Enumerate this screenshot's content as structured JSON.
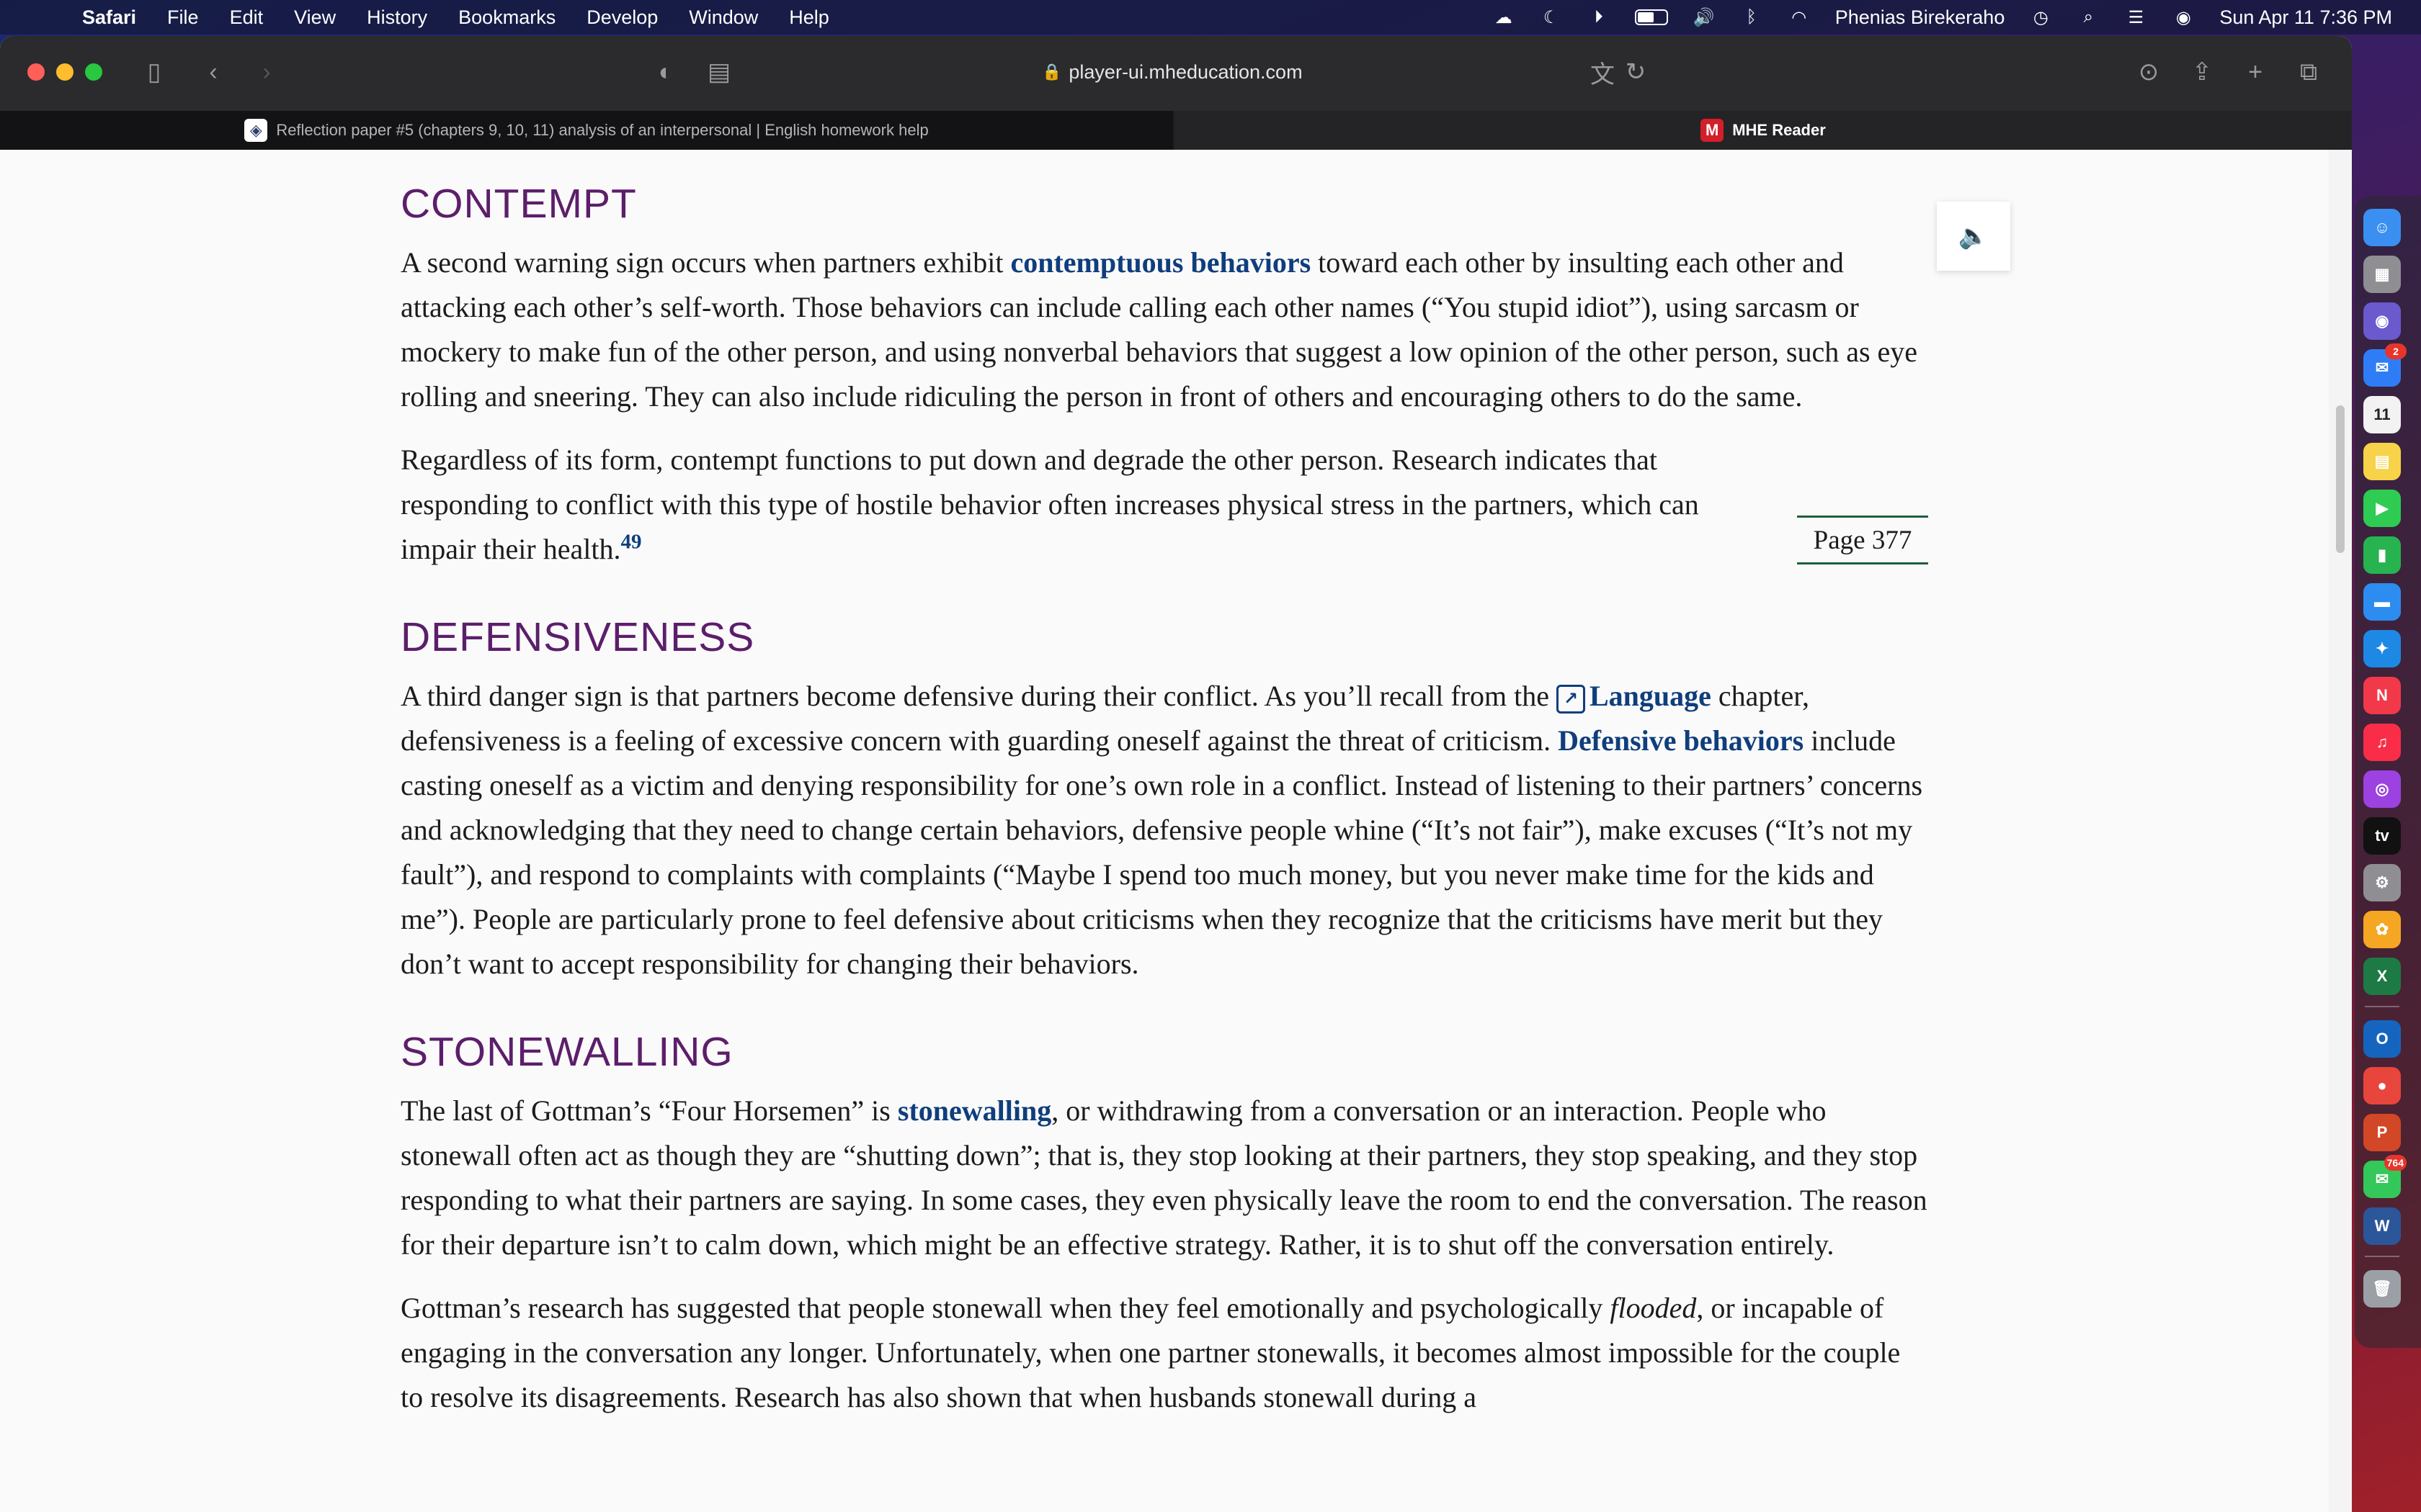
{
  "menubar": {
    "app": "Safari",
    "items": [
      "File",
      "Edit",
      "View",
      "History",
      "Bookmarks",
      "Develop",
      "Window",
      "Help"
    ],
    "user": "Phenias Birekeraho",
    "datetime": "Sun Apr 11  7:36 PM",
    "status_icons": [
      "creative-cloud-icon",
      "moon-icon",
      "play-icon",
      "battery-icon",
      "volume-icon",
      "bluetooth-icon",
      "wifi-icon"
    ],
    "battery_level": 0.6
  },
  "browser": {
    "url": "player-ui.mheducation.com",
    "tabs": [
      {
        "label": "Reflection paper #5 (chapters 9, 10, 11) analysis of an interpersonal | English homework help",
        "active": false
      },
      {
        "label": "MHE Reader",
        "active": true
      }
    ]
  },
  "article": {
    "sections": [
      {
        "heading": "CONTEMPT",
        "p1": {
          "a": "A second warning sign occurs when partners exhibit ",
          "kw": "contemptuous behaviors",
          "b": " toward each other by insulting each other and attacking each other’s self-worth. Those behaviors can include calling each other names (“You stupid idiot”), using sarcasm or mockery to make fun of the other person, and using nonverbal behaviors that suggest a low opinion of the other person, such as eye rolling and sneering. They can also include ridiculing the person in front of others and encouraging others to do the same."
        },
        "p2": {
          "a": "Regardless of its form, contempt functions to put down and degrade the other person. Research indicates that responding to conflict with this type of hostile behavior often increases physical stress in the partners, which can impair their health.",
          "sup": "49"
        }
      },
      {
        "heading": "DEFENSIVENESS",
        "p1": {
          "a": "A third danger sign is that partners become defensive during their conflict. As you’ll recall from the ",
          "link": "Language",
          "b": " chapter, defensiveness is a feeling of excessive concern with guarding oneself against the threat of criticism. ",
          "kw": "Defensive behaviors",
          "c": " include casting oneself as a victim and denying responsibility for one’s own role in a conflict. Instead of listening to their partners’ concerns and acknowledging that they need to change certain behaviors, defensive people whine (“It’s not fair”), make excuses (“It’s not my fault”), and respond to complaints with complaints (“Maybe I spend too much money, but you never make time for the kids and me”). People are particularly prone to feel defensive about criticisms when they recognize that the criticisms have merit but they don’t want to accept responsibility for changing their behaviors."
        }
      },
      {
        "heading": "STONEWALLING",
        "p1": {
          "a": "The last of Gottman’s “Four Horsemen” is ",
          "kw": "stonewalling",
          "b": ", or withdrawing from a conversation or an interaction. People who stonewall often act as though they are “shutting down”; that is, they stop looking at their partners, they stop speaking, and they stop responding to what their partners are saying. In some cases, they even physically leave the room to end the conversation. The reason for their departure isn’t to calm down, which might be an effective strategy. Rather, it is to shut off the conversation entirely."
        },
        "p2": {
          "a": "Gottman’s research has suggested that people stonewall when they feel emotionally and psychologically ",
          "em": "flooded",
          "b": ", or incapable of engaging in the conversation any longer. Unfortunately, when one partner stonewalls, it becomes almost impossible for the couple to resolve its disagreements. Research has also shown that when husbands stonewall during a"
        }
      }
    ],
    "page_marker": "Page 377"
  },
  "dock": {
    "items": [
      {
        "name": "finder",
        "glyph": "☺",
        "color": "#3b8ff0"
      },
      {
        "name": "launchpad",
        "glyph": "▦",
        "color": "#8e8e93"
      },
      {
        "name": "siri",
        "glyph": "◉",
        "color": "#6a5acd"
      },
      {
        "name": "mail",
        "glyph": "✉",
        "color": "#2f7df6",
        "badge": "2"
      },
      {
        "name": "calendar",
        "glyph": "11",
        "color": "#f2f2f2"
      },
      {
        "name": "notes",
        "glyph": "▤",
        "color": "#f7d34a"
      },
      {
        "name": "facetime",
        "glyph": "▶",
        "color": "#2ecc52"
      },
      {
        "name": "numbers",
        "glyph": "▮",
        "color": "#27b350"
      },
      {
        "name": "keynote",
        "glyph": "▬",
        "color": "#2d8cf0"
      },
      {
        "name": "safari",
        "glyph": "✦",
        "color": "#1e88e5"
      },
      {
        "name": "news",
        "glyph": "N",
        "color": "#f2394a"
      },
      {
        "name": "music",
        "glyph": "♫",
        "color": "#fa2d48"
      },
      {
        "name": "podcasts",
        "glyph": "◎",
        "color": "#9b42e0"
      },
      {
        "name": "apple-tv",
        "glyph": "tv",
        "color": "#111111"
      },
      {
        "name": "system-preferences",
        "glyph": "⚙",
        "color": "#8e8e93"
      },
      {
        "name": "photos",
        "glyph": "✿",
        "color": "#f5a623"
      },
      {
        "name": "excel",
        "glyph": "X",
        "color": "#1d7a45"
      },
      {
        "name": "outlook",
        "glyph": "O",
        "color": "#1565c0"
      },
      {
        "name": "chrome",
        "glyph": "●",
        "color": "#e8453c"
      },
      {
        "name": "powerpoint",
        "glyph": "P",
        "color": "#d24726"
      },
      {
        "name": "messages",
        "glyph": "✉",
        "color": "#34c759",
        "badge": "764"
      },
      {
        "name": "word",
        "glyph": "W",
        "color": "#2b579a"
      },
      {
        "name": "trash",
        "glyph": "🗑",
        "color": "#9aa0a6"
      }
    ]
  }
}
